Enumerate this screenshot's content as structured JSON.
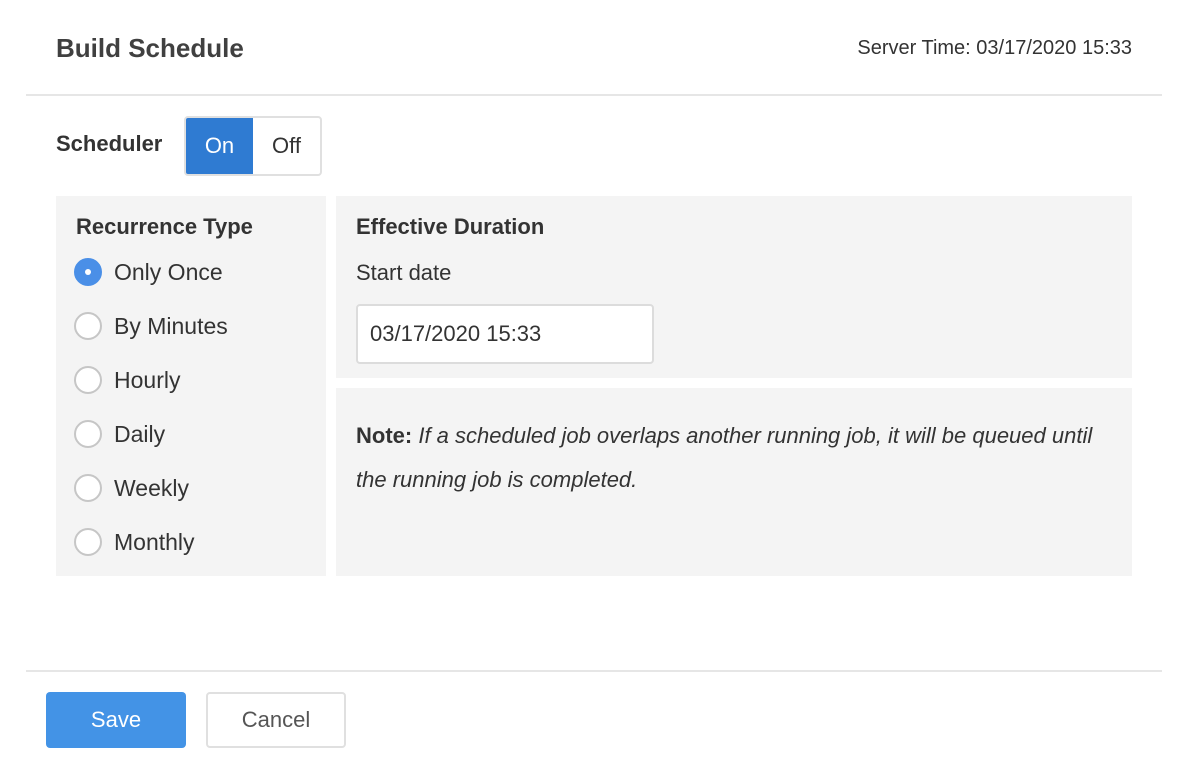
{
  "header": {
    "title": "Build Schedule",
    "server_time": "Server Time: 03/17/2020 15:33"
  },
  "scheduler": {
    "label": "Scheduler",
    "options": [
      "On",
      "Off"
    ],
    "selected": "On"
  },
  "recurrence": {
    "title": "Recurrence Type",
    "options": [
      "Only Once",
      "By Minutes",
      "Hourly",
      "Daily",
      "Weekly",
      "Monthly"
    ],
    "selected": "Only Once"
  },
  "duration": {
    "title": "Effective Duration",
    "start_label": "Start date",
    "start_value": "03/17/2020 15:33"
  },
  "note": {
    "label": "Note:",
    "text": "If a scheduled job overlaps another running job, it will be queued until the running job is completed."
  },
  "footer": {
    "save_label": "Save",
    "cancel_label": "Cancel"
  },
  "colors": {
    "accent": "#2f7bd2",
    "save_button": "#4393e6",
    "radio_checked": "#4a8fe7",
    "panel_bg": "#f4f4f4"
  }
}
